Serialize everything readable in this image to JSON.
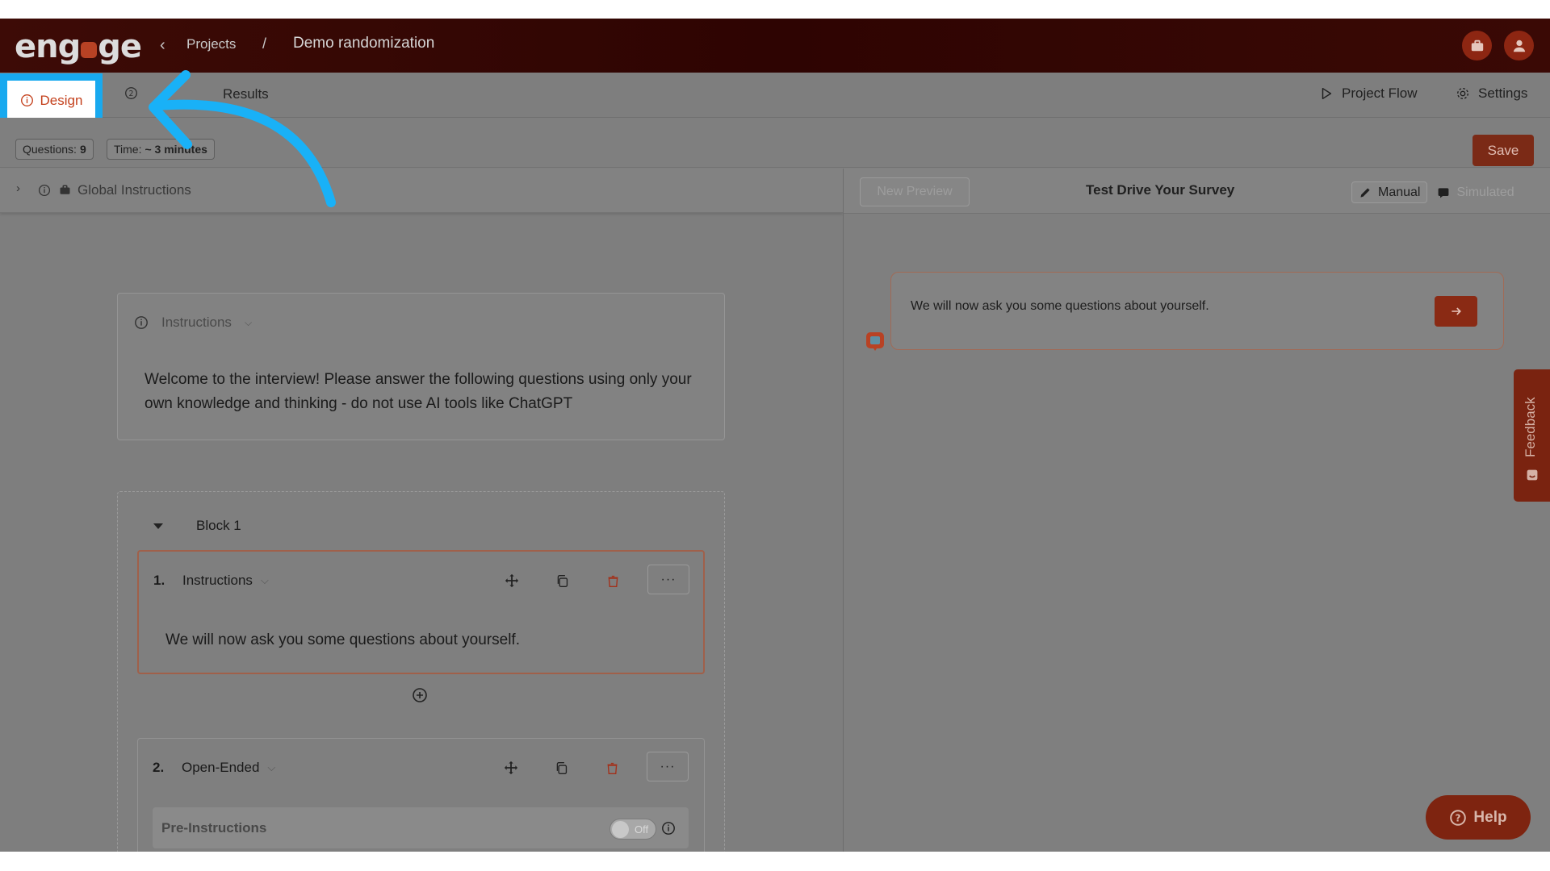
{
  "header": {
    "logo": "engage",
    "breadcrumb_projects": "Projects",
    "breadcrumb_separator": "/",
    "project_title": "Demo randomization"
  },
  "tabs": {
    "design": "Design",
    "questions": "",
    "results": "Results",
    "project_flow": "Project Flow",
    "settings": "Settings"
  },
  "toolbar": {
    "questions_label": "Questions:",
    "questions_count": "9",
    "time_label": "Time:",
    "time_value": "~ 3 minutes",
    "save_label": "Save"
  },
  "global_instructions": {
    "label": "Global Instructions"
  },
  "instructions_card": {
    "label": "Instructions",
    "text": "Welcome to the interview! Please answer the following questions using only your own knowledge and thinking - do not use AI tools like ChatGPT"
  },
  "block": {
    "title": "Block 1",
    "questions": [
      {
        "number": "1.",
        "type": "Instructions",
        "text": "We will now ask you some questions about yourself."
      },
      {
        "number": "2.",
        "type": "Open-Ended",
        "pre_instructions_label": "Pre-Instructions",
        "toggle_state": "Off"
      }
    ]
  },
  "preview": {
    "new_preview_label": "New Preview",
    "title": "Test Drive Your Survey",
    "manual_label": "Manual",
    "simulated_label": "Simulated",
    "message": "We will now ask you some questions about yourself."
  },
  "feedback_label": "Feedback",
  "help_label": "Help",
  "colors": {
    "brand": "#b84224",
    "highlight": "#18a9ef",
    "header_bg": "#2e0402"
  }
}
